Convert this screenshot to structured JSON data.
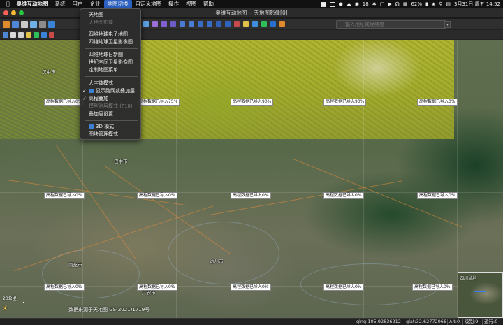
{
  "menubar": {
    "app_name": "奥维互动地图",
    "items": [
      "系统",
      "用户",
      "企业",
      "地图切换",
      "自定义地图",
      "操作",
      "视图",
      "帮助"
    ],
    "status": {
      "wechat_count": "18",
      "battery": "62%",
      "datetime": "3月31日 周五 14:52"
    }
  },
  "window": {
    "title": "奥维互动地图 -- 天地图影像[0]"
  },
  "search": {
    "placeholder": "输入地址或经纬度"
  },
  "dropdown": {
    "items": [
      {
        "label": "天地图",
        "state": "normal"
      },
      {
        "label": "天地图影像",
        "state": "disabled"
      },
      {
        "label": "四维地球电子地图",
        "state": "normal"
      },
      {
        "label": "四维地球卫星影像图",
        "state": "normal"
      },
      {
        "label": "四维地球日新图",
        "state": "normal"
      },
      {
        "label": "世纪空间卫星影像图",
        "state": "normal"
      },
      {
        "label": "定制地图菜单",
        "state": "normal"
      },
      {
        "label": "大字体模式",
        "state": "normal"
      },
      {
        "label": "显示路网或叠加层",
        "state": "checked-icon"
      },
      {
        "label": "高程叠加",
        "state": "checked"
      },
      {
        "label": "模型测层模式 (F10)",
        "state": "disabled"
      },
      {
        "label": "叠加层设置",
        "state": "normal"
      },
      {
        "label": "3D 模式",
        "state": "icon"
      },
      {
        "label": "图块管理模式",
        "state": "normal"
      }
    ]
  },
  "map": {
    "tile_labels": [
      "高程数据已导入0%",
      "高程数据已导入75%",
      "高程数据已导入90%",
      "高程数据已导入90%",
      "高程数据已导入0%",
      "高程数据已导入0%",
      "高程数据已导入0%",
      "高程数据已导入0%",
      "高程数据已导入0%",
      "高程数据已导入0%",
      "高程数据已导入0%",
      "高程数据已导入0%",
      "高程数据已导入0%",
      "高程数据已导入0%",
      "高程数据已导入0%"
    ],
    "cities": [
      "巴中市",
      "达州市",
      "南充市",
      "广安市",
      "汉中市"
    ],
    "scale": "20公里",
    "copyright": "数据来源于天地图 GS(2021)1719号"
  },
  "minimap": {
    "label": "四川盆地"
  },
  "statusbar": {
    "glng": "glng:105.92836212",
    "glat": "glat:32.62772066",
    "alt": "Alt:0",
    "level": "级别:9",
    "run": "运行:0"
  }
}
